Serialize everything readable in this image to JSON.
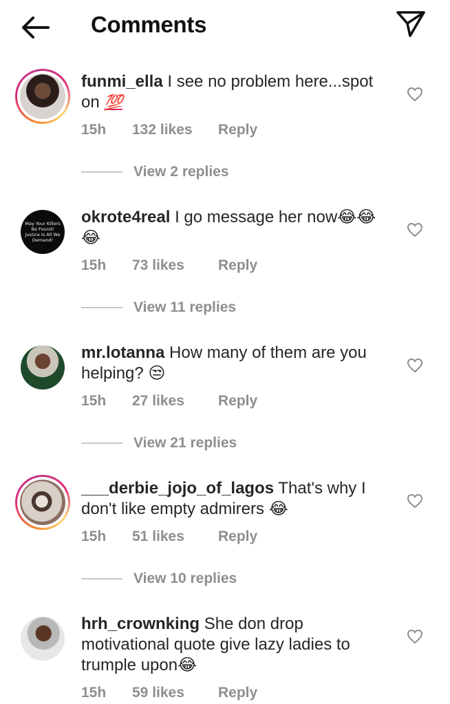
{
  "header": {
    "title": "Comments",
    "back_icon": "arrow-left-icon",
    "share_icon": "paper-plane-icon"
  },
  "comments": [
    {
      "username": "funmi_ella",
      "text": "I see no problem here...spot on",
      "emoji_suffix": "💯",
      "time": "15h",
      "likes": "132 likes",
      "reply": "Reply",
      "view_replies": "View 2 replies",
      "story_ring": true
    },
    {
      "username": "okrote4real",
      "text": "I go message her now",
      "emoji_suffix": "😂😂😂",
      "avatar_text": "May Your Killers Be Found! Justice Is All We Demand!",
      "time": "15h",
      "likes": "73 likes",
      "reply": "Reply",
      "view_replies": "View 11 replies",
      "story_ring": false
    },
    {
      "username": "mr.lotanna",
      "text": "How many of them are you helping?",
      "emoji_suffix": "😒",
      "time": "15h",
      "likes": "27 likes",
      "reply": "Reply",
      "view_replies": "View 21 replies",
      "story_ring": false
    },
    {
      "username": "___derbie_jojo_of_lagos",
      "text": "That's why I don't like empty admirers",
      "emoji_suffix": "😂",
      "time": "15h",
      "likes": "51 likes",
      "reply": "Reply",
      "view_replies": "View 10 replies",
      "story_ring": true
    },
    {
      "username": "hrh_crownking",
      "text": "She don drop motivational quote give lazy ladies to trumple upon",
      "emoji_suffix": "😂",
      "time": "15h",
      "likes": "59 likes",
      "reply": "Reply",
      "story_ring": false
    }
  ],
  "colors": {
    "text": "#262626",
    "muted": "#8e8e8e",
    "story_ring": "#dd2a7b"
  }
}
